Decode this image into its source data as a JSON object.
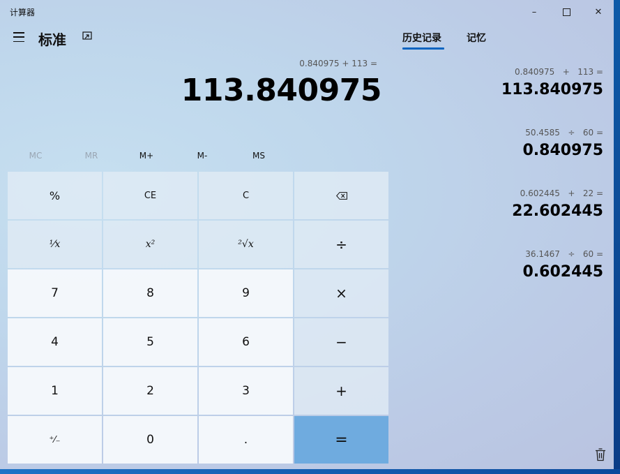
{
  "window": {
    "title": "计算器",
    "controls": {
      "minimize": "–",
      "maximize": "☐",
      "close": "✕"
    }
  },
  "header": {
    "mode_title": "标准"
  },
  "display": {
    "expression": "0.840975 + 113 =",
    "result": "113.840975"
  },
  "memory": {
    "buttons": [
      "MC",
      "MR",
      "M+",
      "M-",
      "MS"
    ]
  },
  "keypad": {
    "percent": "%",
    "ce": "CE",
    "clear": "C",
    "backspace": "⌫",
    "reciprocal": "¹⁄x",
    "square": "x²",
    "sqrt": "²√x",
    "divide": "÷",
    "seven": "7",
    "eight": "8",
    "nine": "9",
    "multiply": "×",
    "four": "4",
    "five": "5",
    "six": "6",
    "subtract": "−",
    "one": "1",
    "two": "2",
    "three": "3",
    "add": "+",
    "negate": "⁺⁄₋",
    "zero": "0",
    "decimal": ".",
    "equals": "="
  },
  "panel": {
    "tabs": {
      "history": "历史记录",
      "memory": "记忆"
    },
    "history": [
      {
        "expression": "0.840975   +   113 =",
        "result": "113.840975"
      },
      {
        "expression": "50.4585   ÷   60 =",
        "result": "0.840975"
      },
      {
        "expression": "0.602445   +   22 =",
        "result": "22.602445"
      },
      {
        "expression": "36.1467   ÷   60 =",
        "result": "0.602445"
      }
    ]
  },
  "colors": {
    "accent": "#0b64c0",
    "equals_key": "#6fabdf"
  }
}
